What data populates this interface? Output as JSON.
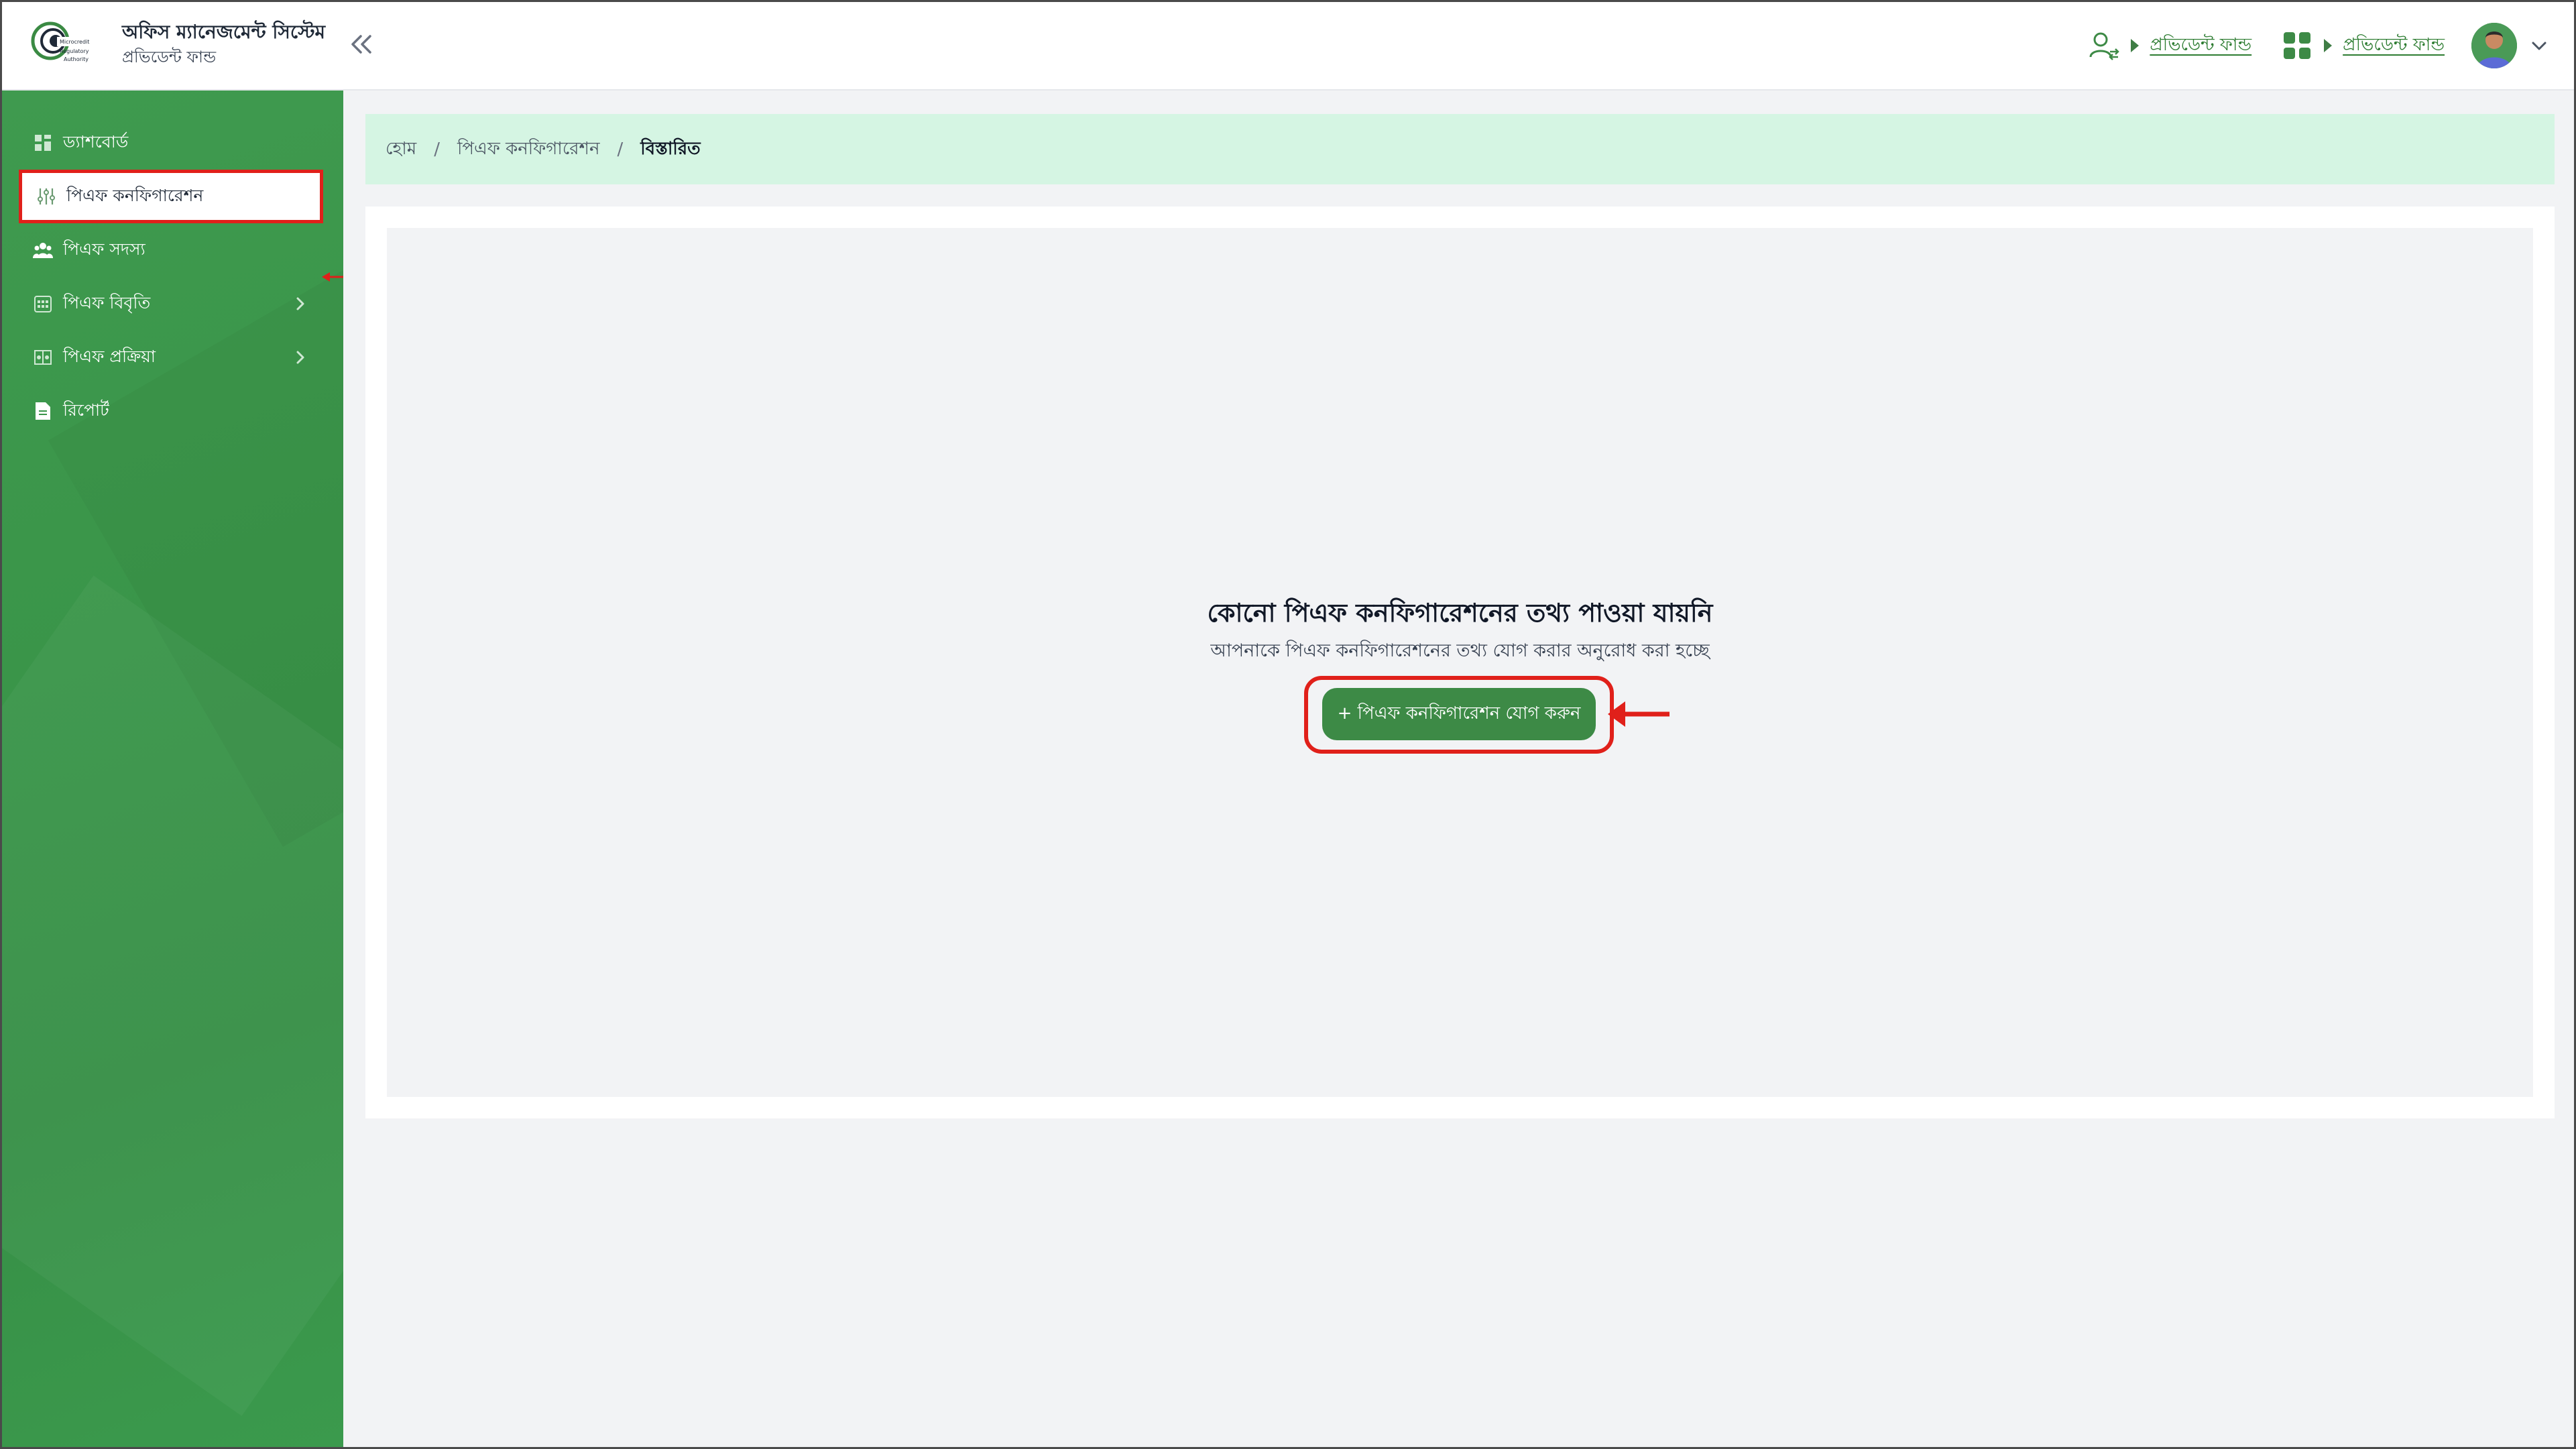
{
  "header": {
    "app_title": "অফিস ম্যানেজমেন্ট সিস্টেম",
    "app_subtitle": "প্রভিডেন্ট ফান্ড",
    "logo_text": [
      "Microcredit",
      "Regulatory",
      "Authority"
    ],
    "links": [
      {
        "icon": "user-switch-icon",
        "label": "প্রভিডেন্ট ফান্ড"
      },
      {
        "icon": "apps-grid-icon",
        "label": "প্রভিডেন্ট ফান্ড"
      }
    ],
    "avatar_icon": "user-avatar"
  },
  "sidebar": {
    "items": [
      {
        "icon": "dashboard-icon",
        "label": "ড্যাশবোর্ড",
        "active": false,
        "has_children": false
      },
      {
        "icon": "sliders-icon",
        "label": "পিএফ কনফিগারেশন",
        "active": true,
        "has_children": false
      },
      {
        "icon": "members-icon",
        "label": "পিএফ সদস্য",
        "active": false,
        "has_children": false
      },
      {
        "icon": "calendar-grid-icon",
        "label": "পিএফ বিবৃতি",
        "active": false,
        "has_children": true
      },
      {
        "icon": "process-icon",
        "label": "পিএফ প্রক্রিয়া",
        "active": false,
        "has_children": true
      },
      {
        "icon": "report-icon",
        "label": "রিপোর্ট",
        "active": false,
        "has_children": false
      }
    ]
  },
  "breadcrumb": {
    "items": [
      "হোম",
      "পিএফ কনফিগারেশন"
    ],
    "current": "বিস্তারিত"
  },
  "empty_state": {
    "title": "কোনো পিএফ কনফিগারেশনের তথ্য পাওয়া যায়নি",
    "subtitle": "আপনাকে পিএফ কনফিগারেশনের তথ্য যোগ করার অনুরোধ করা হচ্ছে",
    "button_label": "+ পিএফ কনফিগারেশন যোগ করুন"
  },
  "colors": {
    "sidebar_green": "#3a9549",
    "accent_green": "#3d8a46",
    "breadcrumb_bg": "#d5f5e3",
    "highlight_red": "#e0201a"
  }
}
